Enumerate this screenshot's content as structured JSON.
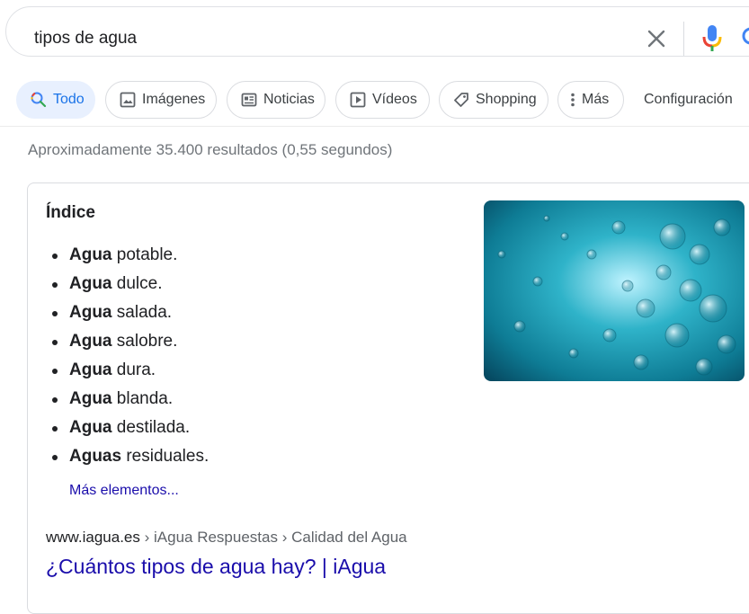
{
  "search": {
    "query": "tipos de agua"
  },
  "tabs": [
    {
      "label": "Todo",
      "icon": "search-icon",
      "active": true
    },
    {
      "label": "Imágenes",
      "icon": "image-icon"
    },
    {
      "label": "Noticias",
      "icon": "news-icon"
    },
    {
      "label": "Vídeos",
      "icon": "video-icon"
    },
    {
      "label": "Shopping",
      "icon": "tag-icon"
    },
    {
      "label": "Más",
      "icon": "more-vert-icon"
    }
  ],
  "config_label": "Configuración",
  "result_stats": "Aproximadamente 35.400 resultados (0,55 segundos)",
  "snippet": {
    "title": "Índice",
    "items": [
      {
        "bold": "Agua",
        "rest": " potable."
      },
      {
        "bold": "Agua",
        "rest": " dulce."
      },
      {
        "bold": "Agua",
        "rest": " salada."
      },
      {
        "bold": "Agua",
        "rest": " salobre."
      },
      {
        "bold": "Agua",
        "rest": " dura."
      },
      {
        "bold": "Agua",
        "rest": " blanda."
      },
      {
        "bold": "Agua",
        "rest": " destilada."
      },
      {
        "bold": "Aguas",
        "rest": " residuales."
      }
    ],
    "more_label": "Más elementos...",
    "source_domain": "www.iagua.es",
    "breadcrumb": " › iAgua Respuestas › Calidad del Agua",
    "result_title": "¿Cuántos tipos de agua hay? | iAgua"
  },
  "colors": {
    "link": "#1a0dab",
    "accent": "#1a73e8",
    "active_chip_bg": "#e8f0fe",
    "muted_text": "#70757a"
  }
}
